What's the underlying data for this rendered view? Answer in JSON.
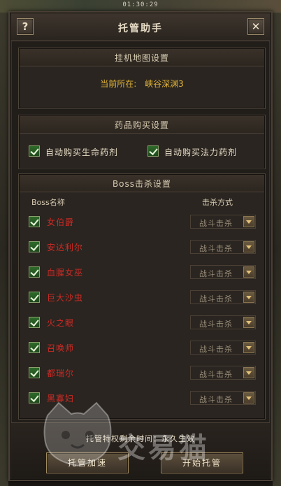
{
  "status_bar": {
    "time": "01:30:29"
  },
  "dialog": {
    "title": "托管助手",
    "help_label": "?",
    "close_label": "✕"
  },
  "map_section": {
    "title": "挂机地图设置",
    "current_label": "当前所在:",
    "current_value": "峡谷深渊3"
  },
  "potion_section": {
    "title": "药品购买设置",
    "options": [
      {
        "label": "自动购买生命药剂",
        "checked": true
      },
      {
        "label": "自动购买法力药剂",
        "checked": true
      }
    ]
  },
  "boss_section": {
    "title": "Boss击杀设置",
    "col_name": "Boss名称",
    "col_method": "击杀方式",
    "bosses": [
      {
        "name": "女伯爵",
        "method": "战斗击杀",
        "checked": true
      },
      {
        "name": "安达利尔",
        "method": "战斗击杀",
        "checked": true
      },
      {
        "name": "血腥女巫",
        "method": "战斗击杀",
        "checked": true
      },
      {
        "name": "巨大沙虫",
        "method": "战斗击杀",
        "checked": true
      },
      {
        "name": "火之眼",
        "method": "战斗击杀",
        "checked": true
      },
      {
        "name": "召唤师",
        "method": "战斗击杀",
        "checked": true
      },
      {
        "name": "都瑞尔",
        "method": "战斗击杀",
        "checked": true
      },
      {
        "name": "黑寡妇",
        "method": "战斗击杀",
        "checked": true
      }
    ]
  },
  "footer": {
    "remaining_text": "托管特权剩余时间：永久生效",
    "speedup_label": "托管加速",
    "start_label": "开始托管"
  },
  "watermark": {
    "text": "交易猫"
  },
  "colors": {
    "boss_name": "#d02a26",
    "map_value": "#e1b43a",
    "checkbox_green": "#2e6a2a"
  }
}
